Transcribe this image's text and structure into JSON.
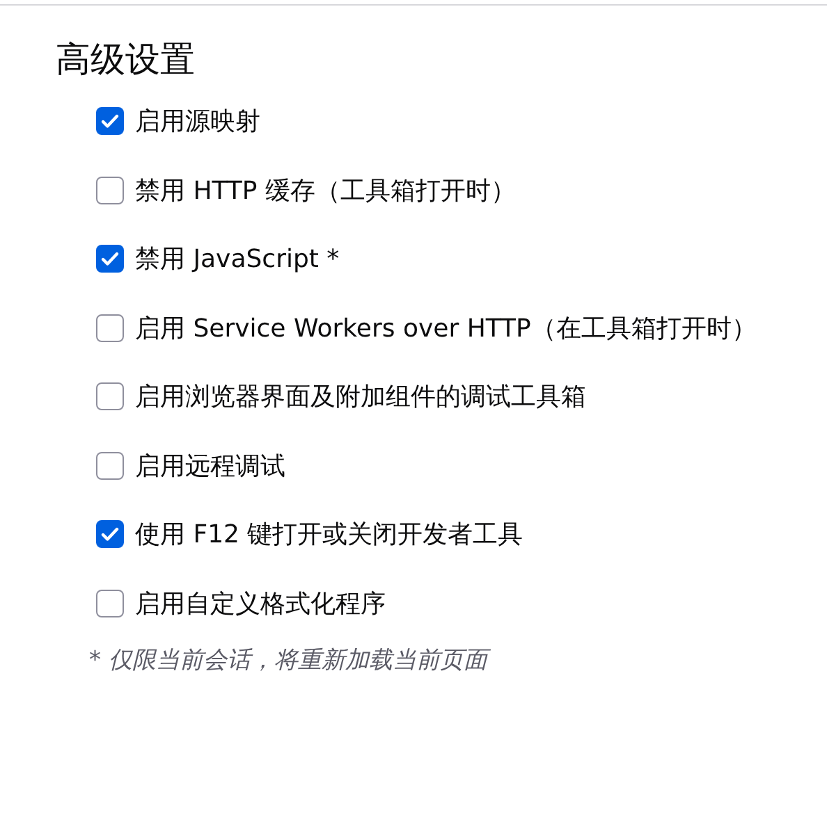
{
  "section": {
    "title": "高级设置"
  },
  "options": [
    {
      "label": "启用源映射",
      "checked": true
    },
    {
      "label": "禁用 HTTP 缓存（工具箱打开时）",
      "checked": false
    },
    {
      "label": "禁用 JavaScript *",
      "checked": true
    },
    {
      "label": "启用 Service Workers over HTTP（在工具箱打开时）",
      "checked": false
    },
    {
      "label": "启用浏览器界面及附加组件的调试工具箱",
      "checked": false
    },
    {
      "label": "启用远程调试",
      "checked": false
    },
    {
      "label": "使用 F12 键打开或关闭开发者工具",
      "checked": true
    },
    {
      "label": "启用自定义格式化程序",
      "checked": false
    }
  ],
  "footnote": "* 仅限当前会话，将重新加载当前页面"
}
